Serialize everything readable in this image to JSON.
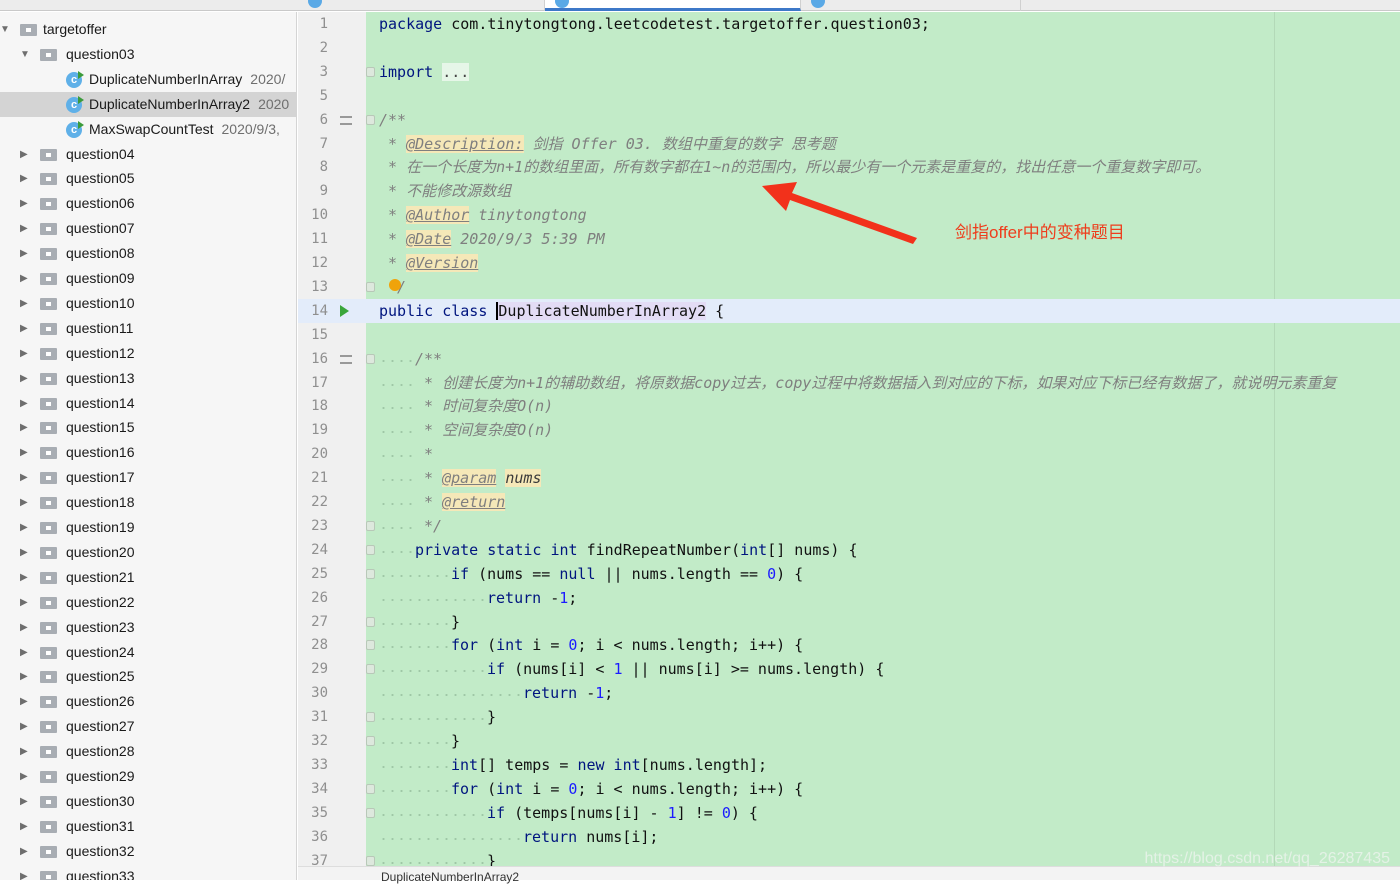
{
  "sidebar": {
    "rows": [
      {
        "label": "targetoffer",
        "level": 0,
        "type": "folder",
        "expanded": true
      },
      {
        "label": "question03",
        "level": 1,
        "type": "folder",
        "expanded": true
      },
      {
        "label": "DuplicateNumberInArray",
        "date": "2020/",
        "level": 2,
        "type": "class"
      },
      {
        "label": "DuplicateNumberInArray2",
        "date": "2020",
        "level": 2,
        "type": "class",
        "selected": true
      },
      {
        "label": "MaxSwapCountTest",
        "date": "2020/9/3,",
        "level": 2,
        "type": "class"
      },
      {
        "label": "question04",
        "level": 1,
        "type": "folder"
      },
      {
        "label": "question05",
        "level": 1,
        "type": "folder"
      },
      {
        "label": "question06",
        "level": 1,
        "type": "folder"
      },
      {
        "label": "question07",
        "level": 1,
        "type": "folder"
      },
      {
        "label": "question08",
        "level": 1,
        "type": "folder"
      },
      {
        "label": "question09",
        "level": 1,
        "type": "folder"
      },
      {
        "label": "question10",
        "level": 1,
        "type": "folder"
      },
      {
        "label": "question11",
        "level": 1,
        "type": "folder"
      },
      {
        "label": "question12",
        "level": 1,
        "type": "folder"
      },
      {
        "label": "question13",
        "level": 1,
        "type": "folder"
      },
      {
        "label": "question14",
        "level": 1,
        "type": "folder"
      },
      {
        "label": "question15",
        "level": 1,
        "type": "folder"
      },
      {
        "label": "question16",
        "level": 1,
        "type": "folder"
      },
      {
        "label": "question17",
        "level": 1,
        "type": "folder"
      },
      {
        "label": "question18",
        "level": 1,
        "type": "folder"
      },
      {
        "label": "question19",
        "level": 1,
        "type": "folder"
      },
      {
        "label": "question20",
        "level": 1,
        "type": "folder"
      },
      {
        "label": "question21",
        "level": 1,
        "type": "folder"
      },
      {
        "label": "question22",
        "level": 1,
        "type": "folder"
      },
      {
        "label": "question23",
        "level": 1,
        "type": "folder"
      },
      {
        "label": "question24",
        "level": 1,
        "type": "folder"
      },
      {
        "label": "question25",
        "level": 1,
        "type": "folder"
      },
      {
        "label": "question26",
        "level": 1,
        "type": "folder"
      },
      {
        "label": "question27",
        "level": 1,
        "type": "folder"
      },
      {
        "label": "question28",
        "level": 1,
        "type": "folder"
      },
      {
        "label": "question29",
        "level": 1,
        "type": "folder"
      },
      {
        "label": "question30",
        "level": 1,
        "type": "folder"
      },
      {
        "label": "question31",
        "level": 1,
        "type": "folder"
      },
      {
        "label": "question32",
        "level": 1,
        "type": "folder"
      },
      {
        "label": "question33",
        "level": 1,
        "type": "folder"
      }
    ]
  },
  "editor": {
    "colors": {
      "background": "#c2ebc8",
      "keyword": "#00157f",
      "number": "#1b1bff",
      "comment": "#7f7f7f",
      "annotation": "#ee3d1c"
    },
    "lines": [
      {
        "n": "1",
        "t": [
          [
            "kw",
            "package"
          ],
          [
            "p",
            " com.tinytongtong.leetcodetest.targetoffer.question03;"
          ]
        ]
      },
      {
        "n": "2",
        "t": []
      },
      {
        "n": "3",
        "fold": true,
        "t": [
          [
            "kw",
            "import"
          ],
          [
            "p",
            " "
          ],
          [
            "fold",
            "..."
          ]
        ]
      },
      {
        "n": "5",
        "t": []
      },
      {
        "n": "6",
        "fold": true,
        "doc": true,
        "t": [
          [
            "c",
            "/**"
          ]
        ]
      },
      {
        "n": "7",
        "t": [
          [
            "c",
            " * "
          ],
          [
            "tag",
            "@Description:"
          ],
          [
            "c",
            " 剑指 Offer 03. 数组中重复的数字 思考题"
          ]
        ]
      },
      {
        "n": "8",
        "t": [
          [
            "c",
            " * 在一个长度为n+1的数组里面，所有数字都在1~n的范围内，所以最少有一个元素是重复的，找出任意一个重复数字即可。"
          ]
        ]
      },
      {
        "n": "9",
        "t": [
          [
            "c",
            " * 不能修改源数组"
          ]
        ]
      },
      {
        "n": "10",
        "t": [
          [
            "c",
            " * "
          ],
          [
            "tag",
            "@Author"
          ],
          [
            "c",
            " tinytongtong"
          ]
        ]
      },
      {
        "n": "11",
        "t": [
          [
            "c",
            " * "
          ],
          [
            "tag",
            "@Date"
          ],
          [
            "c",
            " 2020/9/3 5:39 PM"
          ]
        ]
      },
      {
        "n": "12",
        "t": [
          [
            "c",
            " * "
          ],
          [
            "tag",
            "@Version"
          ]
        ]
      },
      {
        "n": "13",
        "fold": true,
        "bulb": true,
        "t": [
          [
            "c",
            "  /"
          ]
        ]
      },
      {
        "n": "14",
        "run": true,
        "current": true,
        "t": [
          [
            "kw",
            "public class "
          ],
          [
            "clsn",
            "DuplicateNumberInArray2"
          ],
          [
            "p",
            " {"
          ]
        ]
      },
      {
        "n": "15",
        "t": []
      },
      {
        "n": "16",
        "fold": true,
        "doc": true,
        "indent": 4,
        "t": [
          [
            "c",
            "/**"
          ]
        ]
      },
      {
        "n": "17",
        "indent": 4,
        "t": [
          [
            "c",
            " * 创建长度为n+1的辅助数组，将原数据copy过去，copy过程中将数据插入到对应的下标，如果对应下标已经有数据了，就说明元素重复"
          ]
        ]
      },
      {
        "n": "18",
        "indent": 4,
        "t": [
          [
            "c",
            " * 时间复杂度O(n)"
          ]
        ]
      },
      {
        "n": "19",
        "indent": 4,
        "t": [
          [
            "c",
            " * 空间复杂度O(n)"
          ]
        ]
      },
      {
        "n": "20",
        "indent": 4,
        "t": [
          [
            "c",
            " *"
          ]
        ]
      },
      {
        "n": "21",
        "indent": 4,
        "t": [
          [
            "c",
            " * "
          ],
          [
            "tag",
            "@param"
          ],
          [
            "c",
            " "
          ],
          [
            "param",
            "nums"
          ]
        ]
      },
      {
        "n": "22",
        "indent": 4,
        "t": [
          [
            "c",
            " * "
          ],
          [
            "tag",
            "@return"
          ]
        ]
      },
      {
        "n": "23",
        "fold": true,
        "indent": 4,
        "t": [
          [
            "c",
            " */"
          ]
        ]
      },
      {
        "n": "24",
        "fold": true,
        "indent": 4,
        "t": [
          [
            "kw",
            "private static int "
          ],
          [
            "p",
            "findRepeatNumber("
          ],
          [
            "kw",
            "int"
          ],
          [
            "p",
            "[] nums) {"
          ]
        ]
      },
      {
        "n": "25",
        "fold": true,
        "indent": 8,
        "t": [
          [
            "kw",
            "if "
          ],
          [
            "p",
            "(nums == "
          ],
          [
            "kw",
            "null"
          ],
          [
            "p",
            " || nums.length == "
          ],
          [
            "num",
            "0"
          ],
          [
            "p",
            ") {"
          ]
        ]
      },
      {
        "n": "26",
        "indent": 12,
        "t": [
          [
            "kw",
            "return "
          ],
          [
            "p",
            "-"
          ],
          [
            "num",
            "1"
          ],
          [
            "p",
            ";"
          ]
        ]
      },
      {
        "n": "27",
        "fold": true,
        "indent": 8,
        "t": [
          [
            "p",
            "}"
          ]
        ]
      },
      {
        "n": "28",
        "fold": true,
        "indent": 8,
        "t": [
          [
            "kw",
            "for "
          ],
          [
            "p",
            "("
          ],
          [
            "kw",
            "int "
          ],
          [
            "p",
            "i = "
          ],
          [
            "num",
            "0"
          ],
          [
            "p",
            "; i < nums.length; i++) {"
          ]
        ]
      },
      {
        "n": "29",
        "fold": true,
        "indent": 12,
        "t": [
          [
            "kw",
            "if "
          ],
          [
            "p",
            "(nums[i] < "
          ],
          [
            "num",
            "1"
          ],
          [
            "p",
            " || nums[i] >= nums.length) {"
          ]
        ]
      },
      {
        "n": "30",
        "indent": 16,
        "t": [
          [
            "kw",
            "return "
          ],
          [
            "p",
            "-"
          ],
          [
            "num",
            "1"
          ],
          [
            "p",
            ";"
          ]
        ]
      },
      {
        "n": "31",
        "fold": true,
        "indent": 12,
        "t": [
          [
            "p",
            "}"
          ]
        ]
      },
      {
        "n": "32",
        "fold": true,
        "indent": 8,
        "t": [
          [
            "p",
            "}"
          ]
        ]
      },
      {
        "n": "33",
        "indent": 8,
        "t": [
          [
            "kw",
            "int"
          ],
          [
            "p",
            "[] temps = "
          ],
          [
            "kw",
            "new int"
          ],
          [
            "p",
            "[nums.length];"
          ]
        ]
      },
      {
        "n": "34",
        "fold": true,
        "indent": 8,
        "t": [
          [
            "kw",
            "for "
          ],
          [
            "p",
            "("
          ],
          [
            "kw",
            "int "
          ],
          [
            "p",
            "i = "
          ],
          [
            "num",
            "0"
          ],
          [
            "p",
            "; i < nums.length; i++) {"
          ]
        ]
      },
      {
        "n": "35",
        "fold": true,
        "indent": 12,
        "t": [
          [
            "kw",
            "if "
          ],
          [
            "p",
            "(temps[nums[i] - "
          ],
          [
            "num",
            "1"
          ],
          [
            "p",
            "] != "
          ],
          [
            "num",
            "0"
          ],
          [
            "p",
            ") {"
          ]
        ]
      },
      {
        "n": "36",
        "indent": 16,
        "t": [
          [
            "kw",
            "return "
          ],
          [
            "p",
            "nums[i];"
          ]
        ]
      },
      {
        "n": "37",
        "fold": true,
        "indent": 12,
        "t": [
          [
            "p",
            "}"
          ]
        ]
      }
    ],
    "annotation": "剑指offer中的变种题目",
    "breadcrumb": "DuplicateNumberInArray2"
  },
  "watermark": "https://blog.csdn.net/qq_26287435"
}
